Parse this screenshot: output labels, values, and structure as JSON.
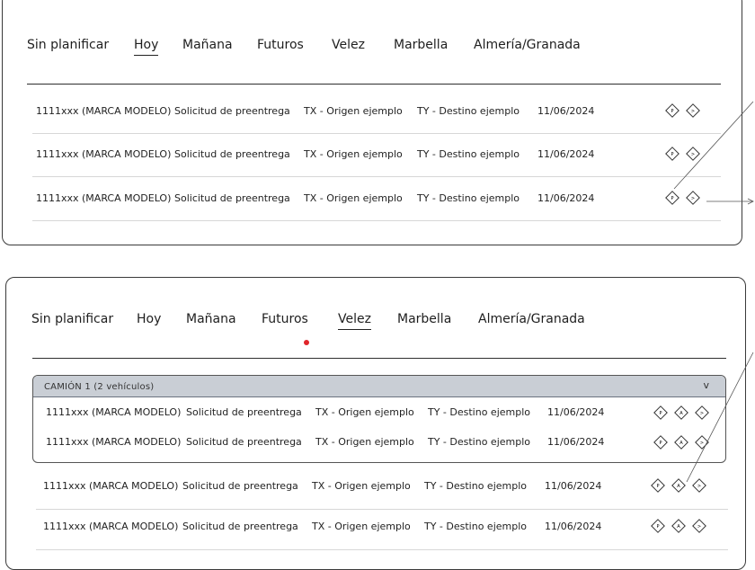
{
  "tabs": {
    "items": [
      "Sin planificar",
      "Hoy",
      "Mañana",
      "Futuros",
      "Velez",
      "Marbella",
      "Almería/Granada"
    ]
  },
  "row": {
    "id": "1111xxx (MARCA MODELO)",
    "type": "Solicitud de preentrega",
    "origin": "TX - Origen ejemplo",
    "destination": "TY - Destino ejemplo",
    "date": "11/06/2024"
  },
  "actions": {
    "p": "P",
    "a": "A",
    "next": ">"
  },
  "group": {
    "title": "CAMIÓN 1 (2 vehículos)",
    "chevron": "v"
  },
  "colors": {
    "header_bg": "#c9ced5",
    "indicator": "#e0262b",
    "lines": "#d7d7d7"
  }
}
